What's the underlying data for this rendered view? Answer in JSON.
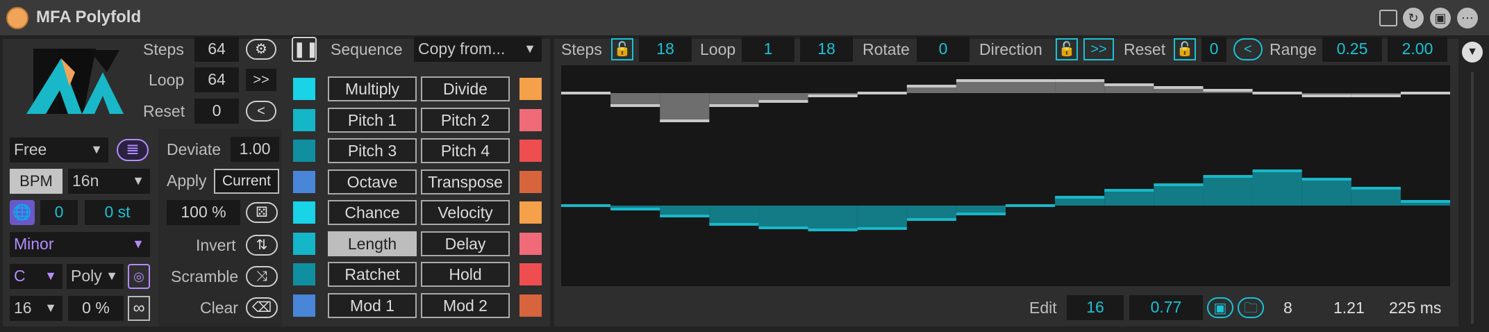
{
  "window": {
    "title": "MFA Polyfold"
  },
  "left": {
    "steps_label": "Steps",
    "steps_value": "64",
    "loop_label": "Loop",
    "loop_value": "64",
    "reset_label": "Reset",
    "reset_value": "0",
    "forward_btn": ">>",
    "back_btn": "<",
    "sync_mode": "Free",
    "bpm_label": "BPM",
    "rate": "16n",
    "tune_value": "0",
    "tune_st": "0 st",
    "scale": "Minor",
    "root": "C",
    "poly": "Poly",
    "divisions": "16",
    "percent": "0 %"
  },
  "mid": {
    "deviate_label": "Deviate",
    "deviate_value": "1.00",
    "apply_label": "Apply",
    "apply_value": "Current",
    "prob_value": "100 %",
    "invert_label": "Invert",
    "scramble_label": "Scramble",
    "clear_label": "Clear"
  },
  "sequence": {
    "label": "Sequence",
    "copy_from": "Copy from...",
    "rows": [
      {
        "left": "Multiply",
        "right": "Divide",
        "lc": "#19d3e6",
        "rc": "#f5a04a"
      },
      {
        "left": "Pitch 1",
        "right": "Pitch 2",
        "lc": "#14b6c8",
        "rc": "#f06a78"
      },
      {
        "left": "Pitch 3",
        "right": "Pitch 4",
        "lc": "#108fa0",
        "rc": "#ee4e50"
      },
      {
        "left": "Octave",
        "right": "Transpose",
        "lc": "#4a86d8",
        "rc": "#d8643e"
      },
      {
        "left": "Chance",
        "right": "Velocity",
        "lc": "#19d3e6",
        "rc": "#f5a04a"
      },
      {
        "left": "Length",
        "right": "Delay",
        "lc": "#14b6c8",
        "rc": "#f06a78"
      },
      {
        "left": "Ratchet",
        "right": "Hold",
        "lc": "#108fa0",
        "rc": "#ee4e50"
      },
      {
        "left": "Mod 1",
        "right": "Mod 2",
        "lc": "#4a86d8",
        "rc": "#d8643e"
      }
    ]
  },
  "right": {
    "steps_label": "Steps",
    "steps_value": "18",
    "loop_label": "Loop",
    "loop_start": "1",
    "loop_end": "18",
    "rotate_label": "Rotate",
    "rotate_value": "0",
    "direction_label": "Direction",
    "direction_value": ">>",
    "reset_label": "Reset",
    "reset_value": "0",
    "reset_dir": "<",
    "range_label": "Range",
    "range_min": "0.25",
    "range_max": "2.00",
    "edit_label": "Edit",
    "edit_step": "16",
    "edit_value": "0.77",
    "stat1": "8",
    "stat2": "1.21",
    "stat3": "225 ms"
  },
  "graph_data": {
    "top_series": [
      0.0,
      0.18,
      0.4,
      0.18,
      0.12,
      0.04,
      0.0,
      -0.1,
      -0.18,
      -0.18,
      -0.18,
      -0.12,
      -0.08,
      -0.04,
      0.0,
      0.04,
      0.04,
      0.0
    ],
    "bottom_series": [
      0.0,
      0.05,
      0.15,
      0.27,
      0.32,
      0.35,
      0.33,
      0.2,
      0.12,
      0.0,
      -0.12,
      -0.22,
      -0.3,
      -0.42,
      -0.5,
      -0.38,
      -0.25,
      -0.06
    ],
    "top_color": "#9a9a9a",
    "bottom_color": "#19b8c8"
  }
}
